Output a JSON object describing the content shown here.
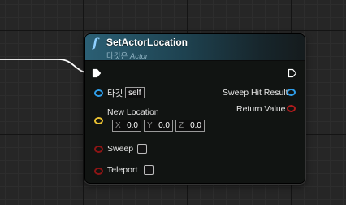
{
  "node": {
    "icon": "function-icon",
    "title": "SetActorLocation",
    "subtitle_prefix": "타깃은 ",
    "subtitle_class": "Actor",
    "header_color": "#2b5f74"
  },
  "pins": {
    "target": {
      "label": "타깃",
      "value": "self",
      "color": "#2f9ee9"
    },
    "new_location": {
      "label": "New Location",
      "color": "#e8c032",
      "x_axis": "X",
      "x_value": "0.0",
      "y_axis": "Y",
      "y_value": "0.0",
      "z_axis": "Z",
      "z_value": "0.0"
    },
    "sweep": {
      "label": "Sweep",
      "color": "#8c1515",
      "checked": false
    },
    "teleport": {
      "label": "Teleport",
      "color": "#8c1515",
      "checked": false
    },
    "sweep_hit_result": {
      "label": "Sweep Hit Result",
      "color": "#2f9ee9"
    },
    "return_value": {
      "label": "Return Value",
      "color": "#b11c1c"
    }
  }
}
